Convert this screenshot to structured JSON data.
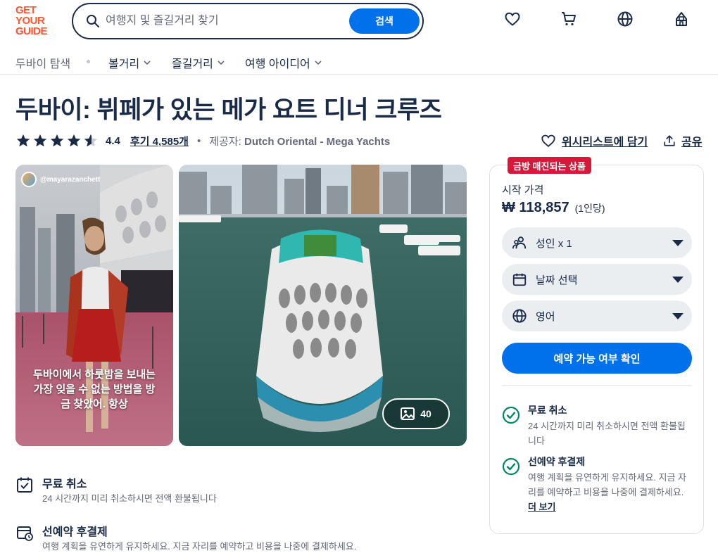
{
  "header": {
    "logo_lines": [
      "GET",
      "YOUR",
      "GUIDE"
    ],
    "search_placeholder": "여행지 및 즐길거리 찾기",
    "search_button": "검색",
    "icons": [
      "heart-icon",
      "cart-icon",
      "globe-icon",
      "profile-icon"
    ]
  },
  "nav": {
    "items": [
      {
        "label": "두바이 탐색"
      },
      {
        "label": "볼거리"
      },
      {
        "label": "즐길거리"
      },
      {
        "label": "여행 아이디어"
      }
    ]
  },
  "product": {
    "title": "두바이: 뷔페가 있는 메가 요트 디너 크루즈",
    "rating": "4.4",
    "rating_stars": 4.4,
    "reviews": "후기 4,585개",
    "bullet": "•",
    "provider_label": "제공자:",
    "provider_name": "Dutch Oriental - Mega Yachts",
    "wishlist": "위시리스트에 담기",
    "share": "공유"
  },
  "gallery": {
    "handle": "@mayarazanchett",
    "caption": "두바이에서 하룻밤을 보내는 가장 잊을 수 없는 방법을 방금 찾았어. 항상",
    "photo_count": "40"
  },
  "booking": {
    "badge": "금방 매진되는 상품",
    "from_label": "시작 가격",
    "price": "₩ 118,857",
    "per": "(1인당)",
    "participants": "성인 x 1",
    "date": "날짜 선택",
    "language": "영어",
    "cta": "예약 가능 여부 확인",
    "features": [
      {
        "title": "무료 취소",
        "desc": "24 시간까지 미리 취소하시면 전액 환불됩니다"
      },
      {
        "title": "선예약 후결제",
        "desc": "여행 계획을 유연하게 유지하세요. 지금 자리를 예약하고 비용을 나중에 결제하세요.",
        "more": "더 보기"
      }
    ]
  },
  "highlights": [
    {
      "title": "무료 취소",
      "desc": "24 시간까지 미리 취소하시면 전액 환불됩니다"
    },
    {
      "title": "선예약 후결제",
      "desc": "여행 계획을 유연하게 유지하세요. 지금 자리를 예약하고 비용을 나중에 결제하세요."
    }
  ],
  "colors": {
    "brand": "#ff5533",
    "primary": "#0071eb",
    "text": "#1a2b49",
    "badge": "#d6193b",
    "check": "#008768"
  }
}
